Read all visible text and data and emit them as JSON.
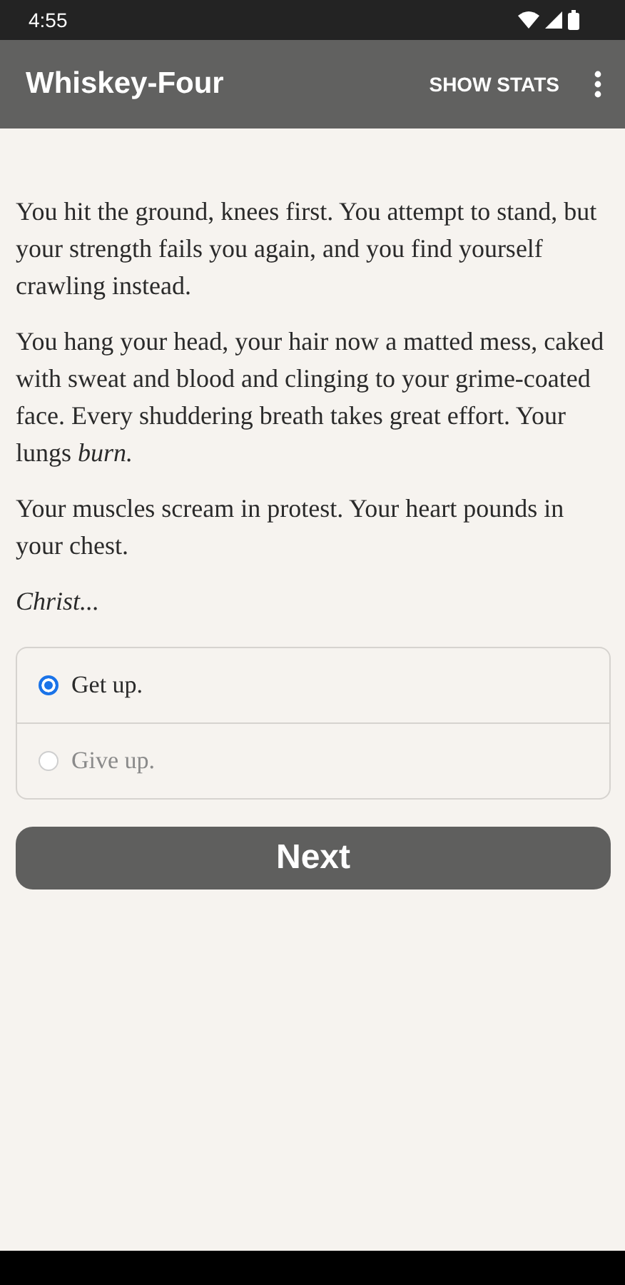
{
  "status_bar": {
    "time": "4:55"
  },
  "app_bar": {
    "title": "Whiskey-Four",
    "action": "SHOW STATS"
  },
  "paragraphs": [
    {
      "text": "You hit the ground, knees first. You attempt to stand, but your strength fails you again, and you find yourself crawling instead.",
      "italic": false
    },
    {
      "text": "You hang your head, your hair now a matted mess, caked with sweat and blood and clinging to your grime-coated face. Every shuddering breath takes great effort. Your lungs *burn.*",
      "italic": false
    },
    {
      "text": "Your muscles scream in protest. Your heart pounds in your chest.",
      "italic": false
    },
    {
      "text": "Christ...",
      "italic": true
    }
  ],
  "choices": [
    {
      "label": "Get up.",
      "selected": true,
      "disabled": false
    },
    {
      "label": "Give up.",
      "selected": false,
      "disabled": true
    }
  ],
  "next_button": {
    "label": "Next"
  }
}
